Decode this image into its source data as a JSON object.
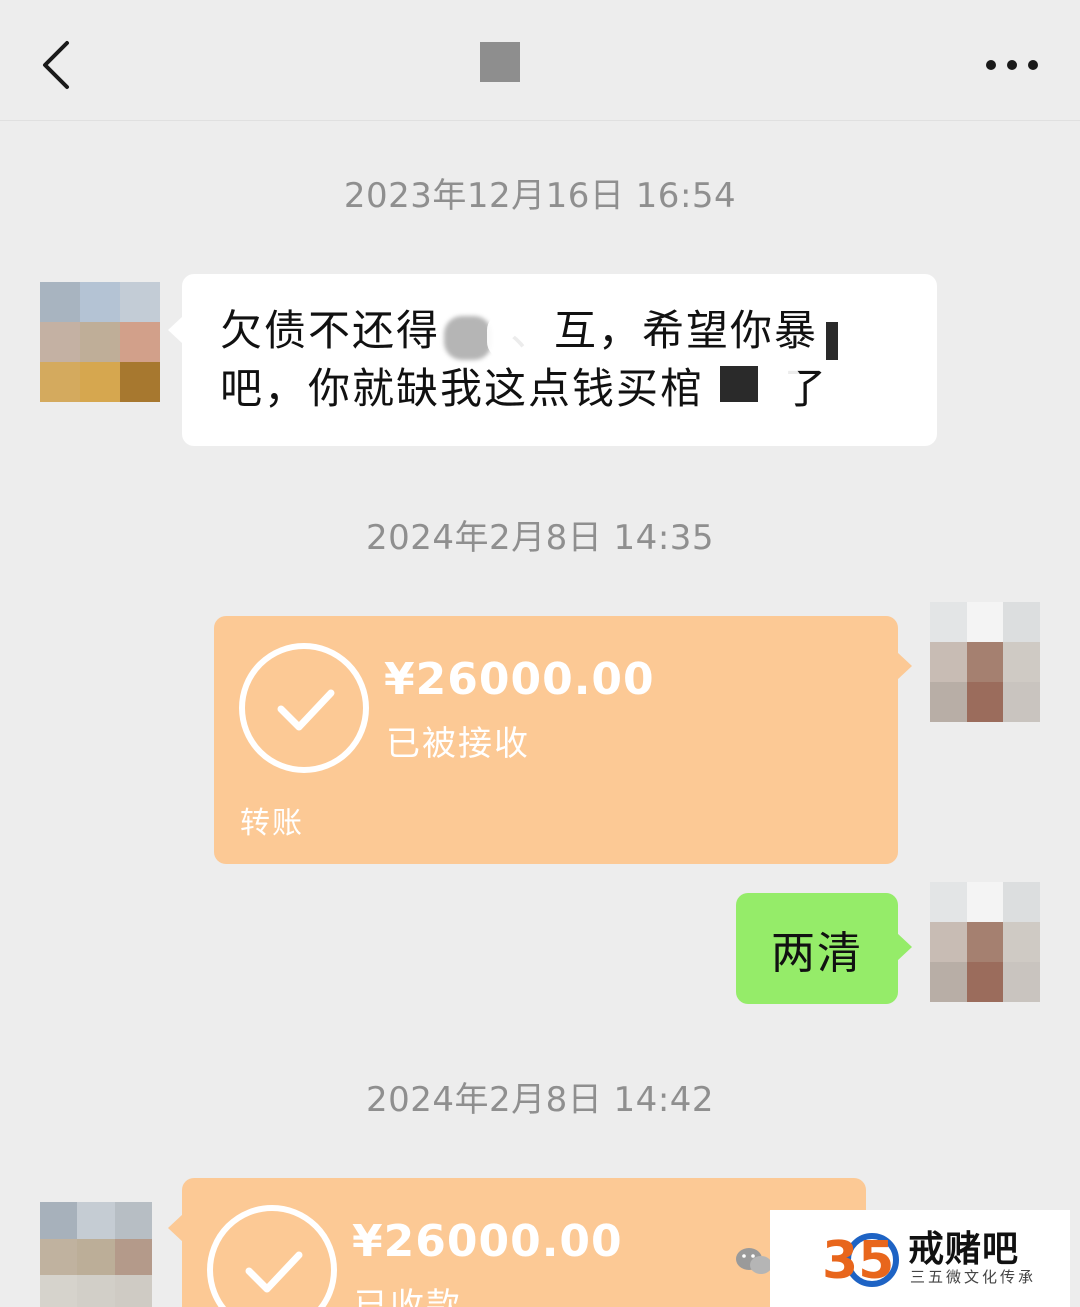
{
  "header": {
    "back_icon": "chevron-left-icon",
    "title": "",
    "more_icon": "more-horizontal-icon"
  },
  "messages": [
    {
      "timestamp": "2023年12月16日 16:54",
      "sender": "other",
      "type": "text",
      "line1": "欠债不还得",
      "line1_mid": "、互",
      "line1_tail": "，希望你暴",
      "line2": "吧，你就缺我这点钱买棺",
      "line2_tail": "了"
    },
    {
      "timestamp": "2024年2月8日 14:35",
      "sender": "me",
      "type": "transfer",
      "amount": "¥26000.00",
      "status": "已被接收",
      "label": "转账"
    },
    {
      "sender": "me",
      "type": "text",
      "text": "两清"
    },
    {
      "timestamp": "2024年2月8日 14:42",
      "sender": "other",
      "type": "transfer",
      "amount": "¥26000.00",
      "status": "已收款"
    }
  ],
  "watermark": {
    "logo_text": "35",
    "name": "戒赌吧",
    "subtitle": "三五微文化传承"
  },
  "colors": {
    "background": "#ededed",
    "bubble_incoming": "#ffffff",
    "bubble_outgoing": "#95ec69",
    "transfer_card": "#fcc995",
    "timestamp_text": "#8f8f8f"
  }
}
